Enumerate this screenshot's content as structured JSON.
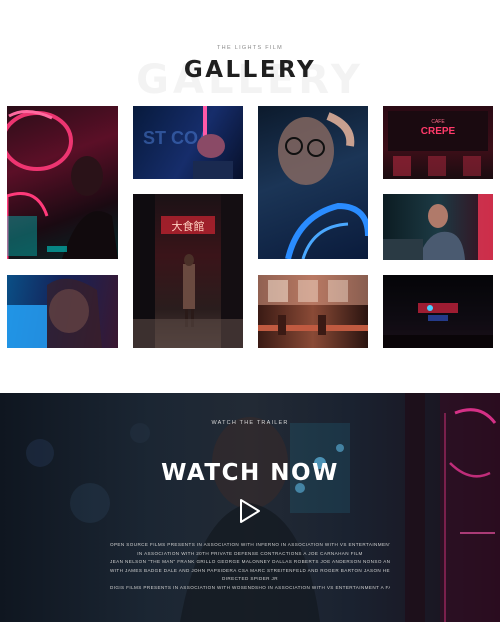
{
  "gallery": {
    "eyebrow": "THE LIGHTS FILM",
    "title": "GALLERY",
    "ghost_title": "GALLERY"
  },
  "trailer": {
    "kicker": "WATCH THE TRAILER",
    "title": "WATCH NOW",
    "credits": [
      "OPEN SOURCE FILMS PRESENTS IN ASSOCIATION WITH INFERNO IN ASSOCIATION WITH VS ENTERTAINMENT A FAUN MONCELLOUS PICTURES PRODUCTION",
      "IN ASSOCIATION WITH 20th PRIVATE DEFENSE CONTRACTIONS A JOE CARNAHAN FILM",
      "JEAN NELSON \"THE MAN\" FRANK GRILLO GEORGE MALONNEY DALLAS ROBERTS JOE ANDERSON NONSO ANOZIE",
      "WITH JAMES BADGE DALE AND JOHN PAPSIDERA CSA MARC STREITENFELD AND ROGER BARTON JASON HELLMANN CSA JOHN WELLEY AND MASANOBU TAKAYANAGI ASC",
      "DIRECTED SPIDER JR",
      "DIGIS FILMS PRESENTS IN ASSOCIATION WITH WOSENDSHO IN ASSOCIATION WITH VS ENTERTAINMENT A FAUN / ROSSEN PICTURES PRODUCTION"
    ]
  }
}
